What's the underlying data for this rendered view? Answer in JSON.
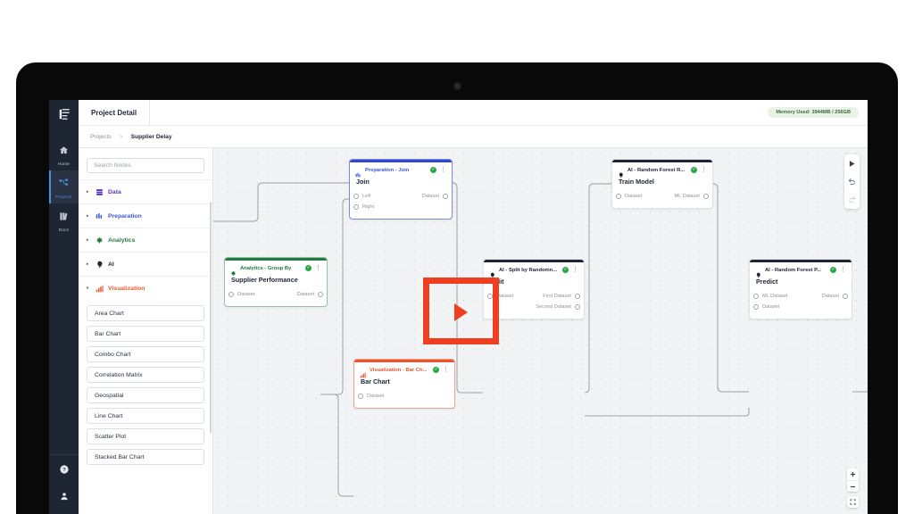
{
  "rail": {
    "logo_icon": "app-logo-icon",
    "items": [
      {
        "label": "Home",
        "icon": "home-icon",
        "active": false
      },
      {
        "label": "Projects",
        "icon": "projects-icon",
        "active": true
      },
      {
        "label": "Docs",
        "icon": "docs-icon",
        "active": false
      }
    ],
    "bottom": [
      {
        "icon": "help-icon"
      },
      {
        "icon": "user-icon"
      }
    ]
  },
  "topbar": {
    "tab_label": "Project Detail",
    "memory_badge": "Memory Used: 3944MB / 256GB",
    "memory_badge_color": "#e8f3e6"
  },
  "breadcrumb": {
    "root": "Projects",
    "separator": ">",
    "current": "Supplier Delay"
  },
  "palette": {
    "search_placeholder": "Search Nodes",
    "search_value": "",
    "categories": [
      {
        "label": "Data",
        "color": "#5b35c7",
        "icon": "database-icon",
        "expanded": false,
        "caret": "▸"
      },
      {
        "label": "Preparation",
        "color": "#3b57d8",
        "icon": "columns-icon",
        "expanded": false,
        "caret": "▸"
      },
      {
        "label": "Analytics",
        "color": "#1f7a3d",
        "icon": "analytics-icon",
        "expanded": false,
        "caret": "▸"
      },
      {
        "label": "AI",
        "color": "#1d2433",
        "icon": "ai-brain-icon",
        "expanded": false,
        "caret": "▸"
      },
      {
        "label": "Visualization",
        "color": "#e8552f",
        "icon": "bars-icon",
        "expanded": true,
        "caret": "▾"
      }
    ],
    "visualization_nodes": [
      "Area Chart",
      "Bar Chart",
      "Combo Chart",
      "Correlation Matrix",
      "Geospatial",
      "Line Chart",
      "Scatter Plot",
      "Stacked Bar Chart"
    ]
  },
  "canvas": {
    "nodes": [
      {
        "id": "join",
        "category": "Preparation - Join",
        "category_color": "#3b57d8",
        "accent": "#2f47c4",
        "icon": "columns-icon",
        "title": "Join",
        "status": "✓",
        "kebab": "⋮",
        "inputs": [
          "Left",
          "Right"
        ],
        "outputs": [
          "Dataset"
        ]
      },
      {
        "id": "train-model",
        "category": "AI - Random Forest R...",
        "category_color": "#1d2433",
        "accent": "#1d2433",
        "icon": "ai-brain-icon",
        "title": "Train Model",
        "status": "✓",
        "kebab": "⋮",
        "inputs": [
          "Dataset"
        ],
        "outputs": [
          "ML Dataset"
        ]
      },
      {
        "id": "supplier-performance",
        "category": "Analytics - Group By",
        "category_color": "#1f7a3d",
        "accent": "#1f7a3d",
        "icon": "analytics-icon",
        "title": "Supplier Performance",
        "status": "✓",
        "kebab": "⋮",
        "inputs": [
          "Dataset"
        ],
        "outputs": [
          "Dataset"
        ]
      },
      {
        "id": "split",
        "category": "AI - Split by Randomn...",
        "category_color": "#1d2433",
        "accent": "#1d2433",
        "icon": "ai-brain-icon",
        "title": "Split",
        "status": "✓",
        "kebab": "⋮",
        "inputs": [
          "Dataset"
        ],
        "outputs": [
          "First Dataset",
          "Second Dataset"
        ]
      },
      {
        "id": "predict",
        "category": "AI - Random Forest P...",
        "category_color": "#1d2433",
        "accent": "#1d2433",
        "icon": "ai-brain-icon",
        "title": "Predict",
        "status": "✓",
        "kebab": "⋮",
        "inputs": [
          "ML Dataset",
          "Dataset"
        ],
        "outputs": [
          "Dataset"
        ]
      },
      {
        "id": "bar-chart",
        "category": "Visualization - Bar Ch...",
        "category_color": "#e8552f",
        "accent": "#e8552f",
        "icon": "bars-icon",
        "title": "Bar Chart",
        "status": "✓",
        "kebab": "⋮",
        "inputs": [
          "Dataset"
        ],
        "outputs": []
      }
    ],
    "toolbar": [
      {
        "name": "run-button",
        "icon": "play-icon",
        "enabled": true
      },
      {
        "name": "undo-button",
        "icon": "undo-icon",
        "enabled": true
      },
      {
        "name": "redo-button",
        "icon": "redo-icon",
        "enabled": false
      }
    ],
    "zoom_controls": [
      {
        "name": "zoom-in-button",
        "label": "+"
      },
      {
        "name": "zoom-out-button",
        "label": "−"
      },
      {
        "name": "fit-to-screen-button",
        "label": "⛶"
      }
    ]
  },
  "annotation": {
    "color": "#f03e20",
    "icon": "play-triangle-icon"
  }
}
